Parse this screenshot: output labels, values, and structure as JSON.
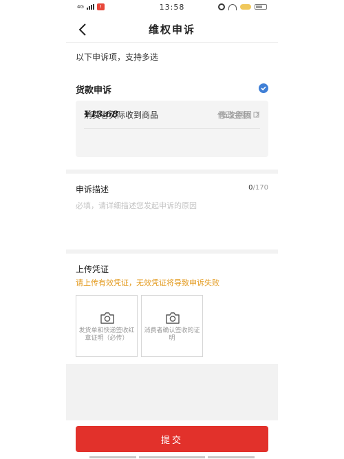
{
  "status_bar": {
    "network": "4G",
    "app_badge": "!",
    "time": "13:58"
  },
  "nav": {
    "title": "维权申诉"
  },
  "hint": "以下申诉项，支持多选",
  "refund": {
    "heading": "货款申诉",
    "checked": true,
    "rows": [
      {
        "label": "消费者实际收到商品",
        "action": "修改原因",
        "action_icon": "chevron-right-icon"
      },
      {
        "label": "¥13.68",
        "action": "修改金额",
        "action_icon": "edit-icon"
      }
    ]
  },
  "description": {
    "title": "申诉描述",
    "count": "0",
    "max": "/170",
    "placeholder": "必填，请详细描述您发起申诉的原因"
  },
  "upload": {
    "title": "上传凭证",
    "warning": "请上传有效凭证，无效凭证将导致申诉失败",
    "tiles": [
      {
        "label": "发货单和快递签收红章证明（必传）",
        "icon": "camera-icon"
      },
      {
        "label": "消费者确认签收的证明",
        "icon": "camera-icon"
      }
    ]
  },
  "submit_label": "提交",
  "colors": {
    "accent_red": "#e2312b",
    "warning_orange": "#e39a1e",
    "check_blue": "#3f7fd6"
  }
}
